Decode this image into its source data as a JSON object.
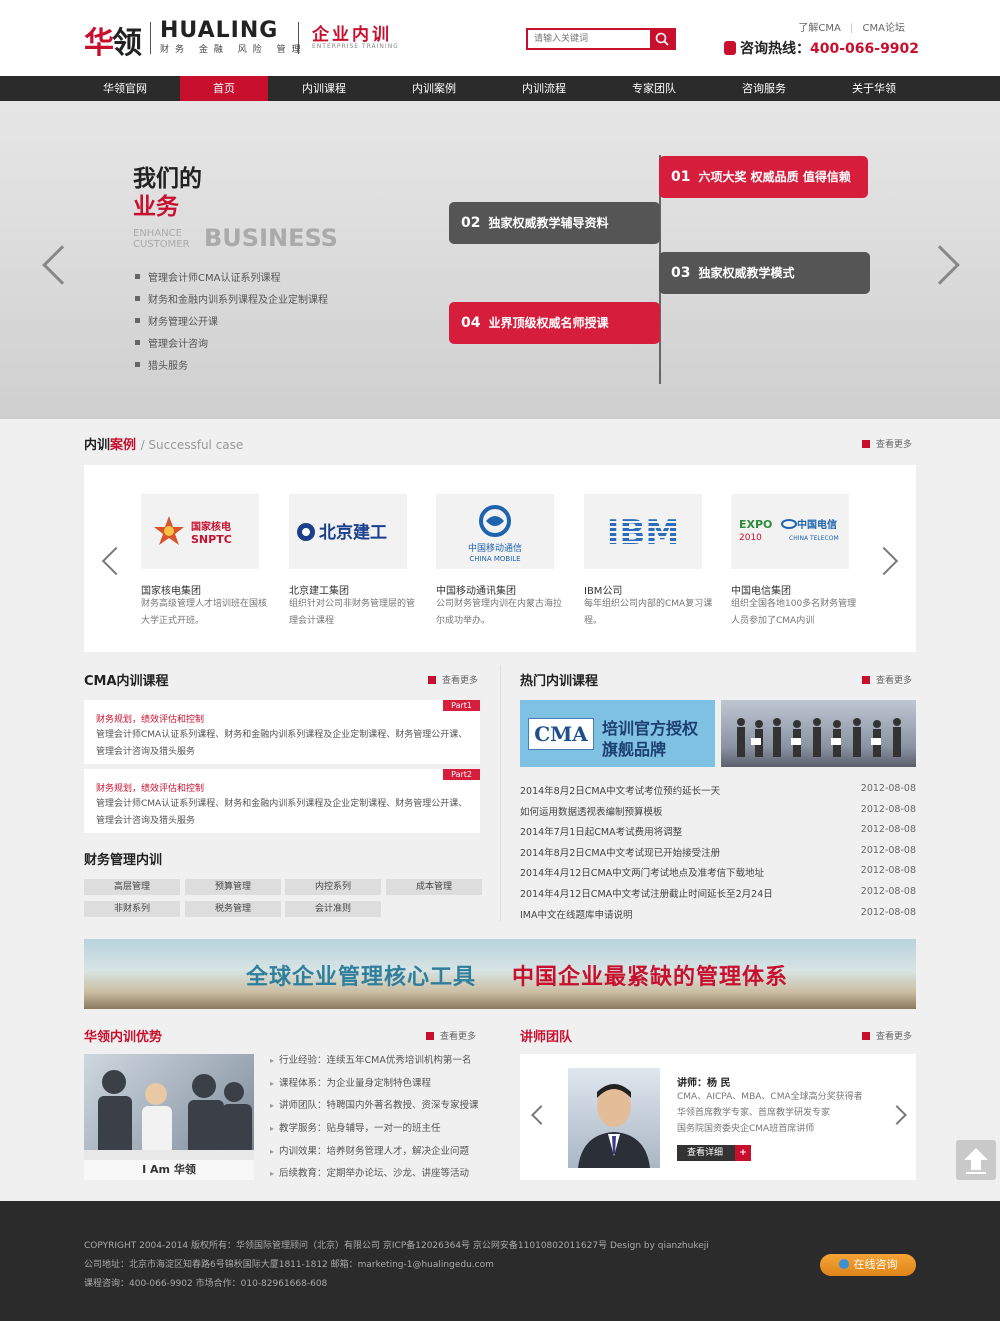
{
  "header": {
    "logo_cn_1": "华",
    "logo_cn_2": "领",
    "logo_en": "HUALING",
    "logo_sub": "财务 金融 风险 管理",
    "logo_enterprise": "企业内训",
    "logo_enterprise_en": "ENTERPRISE TRAINING",
    "search_placeholder": "请输入关键词",
    "link_cma": "了解CMA",
    "link_forum": "CMA论坛",
    "hotline_label": "咨询热线：",
    "hotline_number": "400-066-9902"
  },
  "nav": [
    "华领官网",
    "首页",
    "内训课程",
    "内训案例",
    "内训流程",
    "专家团队",
    "咨询服务",
    "关于华领"
  ],
  "banner": {
    "title_1": "我们的",
    "title_2": "业务",
    "en_small_1": "ENHANCE",
    "en_small_2": "CUSTOMER",
    "en_big": "BUSINESS",
    "list": [
      "管理会计师CMA认证系列课程",
      "财务和金融内训系列课程及企业定制课程",
      "财务管理公开课",
      "管理会计咨询",
      "猎头服务"
    ],
    "bubbles": [
      {
        "num": "01",
        "text": "六项大奖 权威品质 值得信赖"
      },
      {
        "num": "02",
        "text": "独家权威教学辅导资料"
      },
      {
        "num": "03",
        "text": "独家权威教学模式"
      },
      {
        "num": "04",
        "text": "业界顶级权威名师授课"
      }
    ]
  },
  "cases": {
    "title_1": "内训",
    "title_2": "案例",
    "title_sub": "/ Successful case",
    "more": "查看更多",
    "items": [
      {
        "logo": "国家核电 SNPTC",
        "name": "国家核电集团",
        "desc": "财务高级管理人才培训班在国核大学正式开班。"
      },
      {
        "logo": "北京建工",
        "name": "北京建工集团",
        "desc": "组织针对公司非财务管理层的管理会计课程"
      },
      {
        "logo": "中国移动通信 CHINA MOBILE",
        "name": "中国移动通讯集团",
        "desc": "公司财务管理内训在内蒙古海拉尔成功举办。"
      },
      {
        "logo": "IBM",
        "name": "IBM公司",
        "desc": "每年组织公司内部的CMA复习课程。"
      },
      {
        "logo": "中国电信 CHINA TELECOM",
        "name": "中国电信集团",
        "desc": "组织全国各地100多名财务管理人员参加了CMA内训"
      }
    ]
  },
  "cma_training": {
    "title": "CMA内训课程",
    "more": "查看更多",
    "parts": [
      {
        "tag": "Part1",
        "heading": "财务规划，绩效评估和控制",
        "desc": "管理会计师CMA认证系列课程、财务和金融内训系列课程及企业定制课程、财务管理公开课、管理会计咨询及猎头服务"
      },
      {
        "tag": "Part2",
        "heading": "财务规划，绩效评估和控制",
        "desc": "管理会计师CMA认证系列课程、财务和金融内训系列课程及企业定制课程、财务管理公开课、管理会计咨询及猎头服务"
      }
    ]
  },
  "finance": {
    "title": "财务管理内训",
    "tags": [
      "高层管理",
      "预算管理",
      "内控系列",
      "成本管理",
      "非财系列",
      "税务管理",
      "会计准则"
    ]
  },
  "hot": {
    "title": "热门内训课程",
    "more": "查看更多",
    "promo_logo": "CMA",
    "promo_text_1": "培训官方授权",
    "promo_text_2": "旗舰品牌",
    "news": [
      {
        "t": "2014年8月2日CMA中文考试考位预约延长一天",
        "d": "2012-08-08"
      },
      {
        "t": "如何运用数据透视表编制预算模板",
        "d": "2012-08-08"
      },
      {
        "t": "2014年7月1日起CMA考试费用将调整",
        "d": "2012-08-08"
      },
      {
        "t": "2014年8月2日CMA中文考试现已开始接受注册",
        "d": "2012-08-08"
      },
      {
        "t": "2014年4月12日CMA中文两门考试地点及准考信下载地址",
        "d": "2012-08-08"
      },
      {
        "t": "2014年4月12日CMA中文考试注册截止时间延长至2月24日",
        "d": "2012-08-08"
      },
      {
        "t": "IMA中文在线题库申请说明",
        "d": "2012-08-08"
      }
    ]
  },
  "slogan": {
    "left": "全球企业管理核心工具",
    "right": "中国企业最紧缺的管理体系"
  },
  "advantages": {
    "title": "华领内训优势",
    "more": "查看更多",
    "caption": "I Am 华领",
    "items": [
      "行业经验：连续五年CMA优秀培训机构第一名",
      "课程体系：为企业量身定制特色课程",
      "讲师团队：特聘国内外著名教授、资深专家授课",
      "教学服务：贴身辅导，一对一的班主任",
      "内训效果：培养财务管理人才，解决企业问题",
      "后续教育：定期举办论坛、沙龙、讲座等活动"
    ]
  },
  "teachers": {
    "title": "讲师团队",
    "more": "查看更多",
    "name": "讲师：杨 民",
    "desc_1": "CMA、AICPA、MBA、CMA全球高分奖获得者",
    "desc_2": "华领首席教学专家、首席教学研发专家",
    "desc_3": "国务院国资委央企CMA班首席讲师",
    "detail": "查看详细"
  },
  "footer": {
    "line1": "COPYRIGHT  2004-2014 版权所有：华领国际管理顾问（北京）有限公司 京ICP备12026364号 京公网安备11010802011627号    Design by qianzhukeji",
    "line2": "公司地址：北京市海淀区知春路6号锦秋国际大厦1811-1812      邮箱：marketing-1@hualingedu.com",
    "line3": "课程咨询：400-066-9902    市场合作：010-82961668-608",
    "online": "在线咨询"
  },
  "colors": {
    "brand_red": "#c8102e",
    "nav_bg": "#2b2b2b",
    "footer_bg": "#2b2b2b"
  }
}
